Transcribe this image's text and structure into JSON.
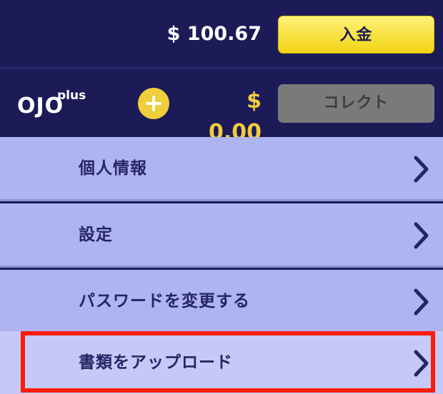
{
  "account": {
    "balance": "$ 100.67",
    "deposit_label": "入金"
  },
  "bonus": {
    "logo_main": "OJO",
    "logo_sup": "plus",
    "amount": "$ 0.00",
    "collect_label": "コレクト"
  },
  "menu": {
    "items": [
      {
        "label": "個人情報",
        "icon": "chevron-right-icon"
      },
      {
        "label": "設定",
        "icon": "chevron-right-icon"
      },
      {
        "label": "パスワードを変更する",
        "icon": "chevron-right-icon"
      },
      {
        "label": "書類をアップロード",
        "icon": "chevron-right-icon"
      }
    ]
  },
  "colors": {
    "navy": "#1c1b58",
    "deposit_yellow": "#f2d313",
    "bonus_gold": "#f1ce3c",
    "menu_bg": "#aeb4f0",
    "highlight_red": "#ff1b0b"
  }
}
